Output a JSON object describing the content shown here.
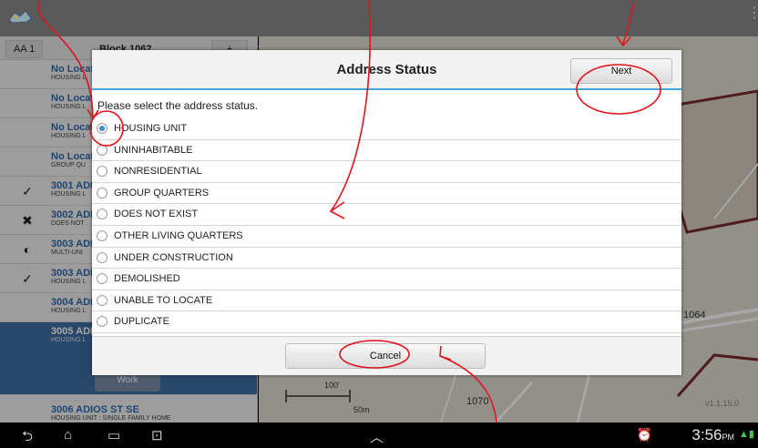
{
  "left_panel": {
    "tab_left": "AA 1",
    "tab_block": "Block 1062",
    "tab_plus": "+",
    "rows": [
      {
        "title": "No Locat",
        "sub": "HOUSING L",
        "mark": ""
      },
      {
        "title": "No Locat",
        "sub": "HOUSING L",
        "mark": ""
      },
      {
        "title": "No Locat",
        "sub": "HOUSING L",
        "mark": ""
      },
      {
        "title": "No Locat",
        "sub": "GROUP QU",
        "mark": ""
      },
      {
        "title": "3001 ADI",
        "sub": "HOUSING L",
        "mark": "✓"
      },
      {
        "title": "3002 ADI",
        "sub": "DOES NOT",
        "mark": "✖"
      },
      {
        "title": "3003 ADI",
        "sub": "MULTI-UNI",
        "mark": "◐"
      },
      {
        "title": "3003 ADI",
        "sub": "HOUSING L",
        "mark": "✓"
      },
      {
        "title": "3004 ADI",
        "sub": "HOUSING L",
        "mark": ""
      }
    ],
    "selected_row": {
      "title": "3005 ADI",
      "sub": "HOUSING L",
      "button": "Work"
    },
    "last_row": {
      "title": "3006 ADIOS ST SE",
      "sub": "HOUSING UNIT : SINGLE FAMILY HOME"
    }
  },
  "map": {
    "label_1064": "1064",
    "label_1070": "1070",
    "scale_ft": "100'",
    "scale_m": "50m",
    "version": "v1.1.15.0"
  },
  "dialog": {
    "title": "Address Status",
    "next_label": "Next",
    "prompt": "Please select the address status.",
    "options": [
      "HOUSING UNIT",
      "UNINHABITABLE",
      "NONRESIDENTIAL",
      "GROUP QUARTERS",
      "DOES NOT EXIST",
      "OTHER LIVING QUARTERS",
      "UNDER CONSTRUCTION",
      "DEMOLISHED",
      "UNABLE TO LOCATE",
      "DUPLICATE"
    ],
    "selected_option": "HOUSING UNIT",
    "cancel_label": "Cancel"
  },
  "statusbar": {
    "time": "3:56",
    "ampm": "PM"
  },
  "colors": {
    "accent": "#45a6d8",
    "selected_row": "#3f6da3",
    "annotation": "#e0141e"
  }
}
